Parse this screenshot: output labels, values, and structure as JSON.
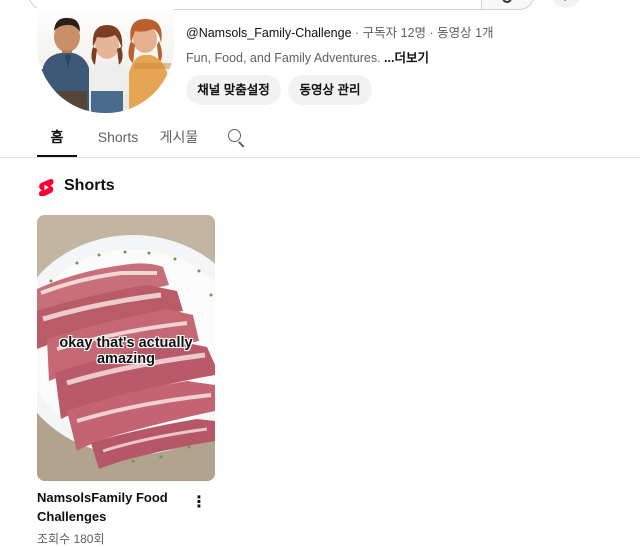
{
  "header": {
    "search_icon": "search-icon",
    "action_icon": "plus-icon",
    "action_glyph": "+"
  },
  "channel": {
    "handle": "@Namsols_Family-Challenge",
    "meta": " · 구독자 12명 · 동영상 1개",
    "description": "Fun, Food, and Family Adventures. ",
    "more_label": "...더보기",
    "buttons": [
      "채널 맞춤설정",
      "동영상 관리"
    ]
  },
  "tabs": [
    {
      "label": "홈",
      "active": true
    },
    {
      "label": "Shorts",
      "active": false
    },
    {
      "label": "게시물",
      "active": false
    }
  ],
  "shorts_section": {
    "title": "Shorts",
    "icon": "youtube-shorts-icon",
    "brand_color": "#ff0033",
    "items": [
      {
        "caption": "okay that's actually amazing",
        "title": "NamsolsFamily Food Challenges",
        "views": "조회수 180회",
        "menu_icon": "more-vert-icon"
      }
    ]
  }
}
